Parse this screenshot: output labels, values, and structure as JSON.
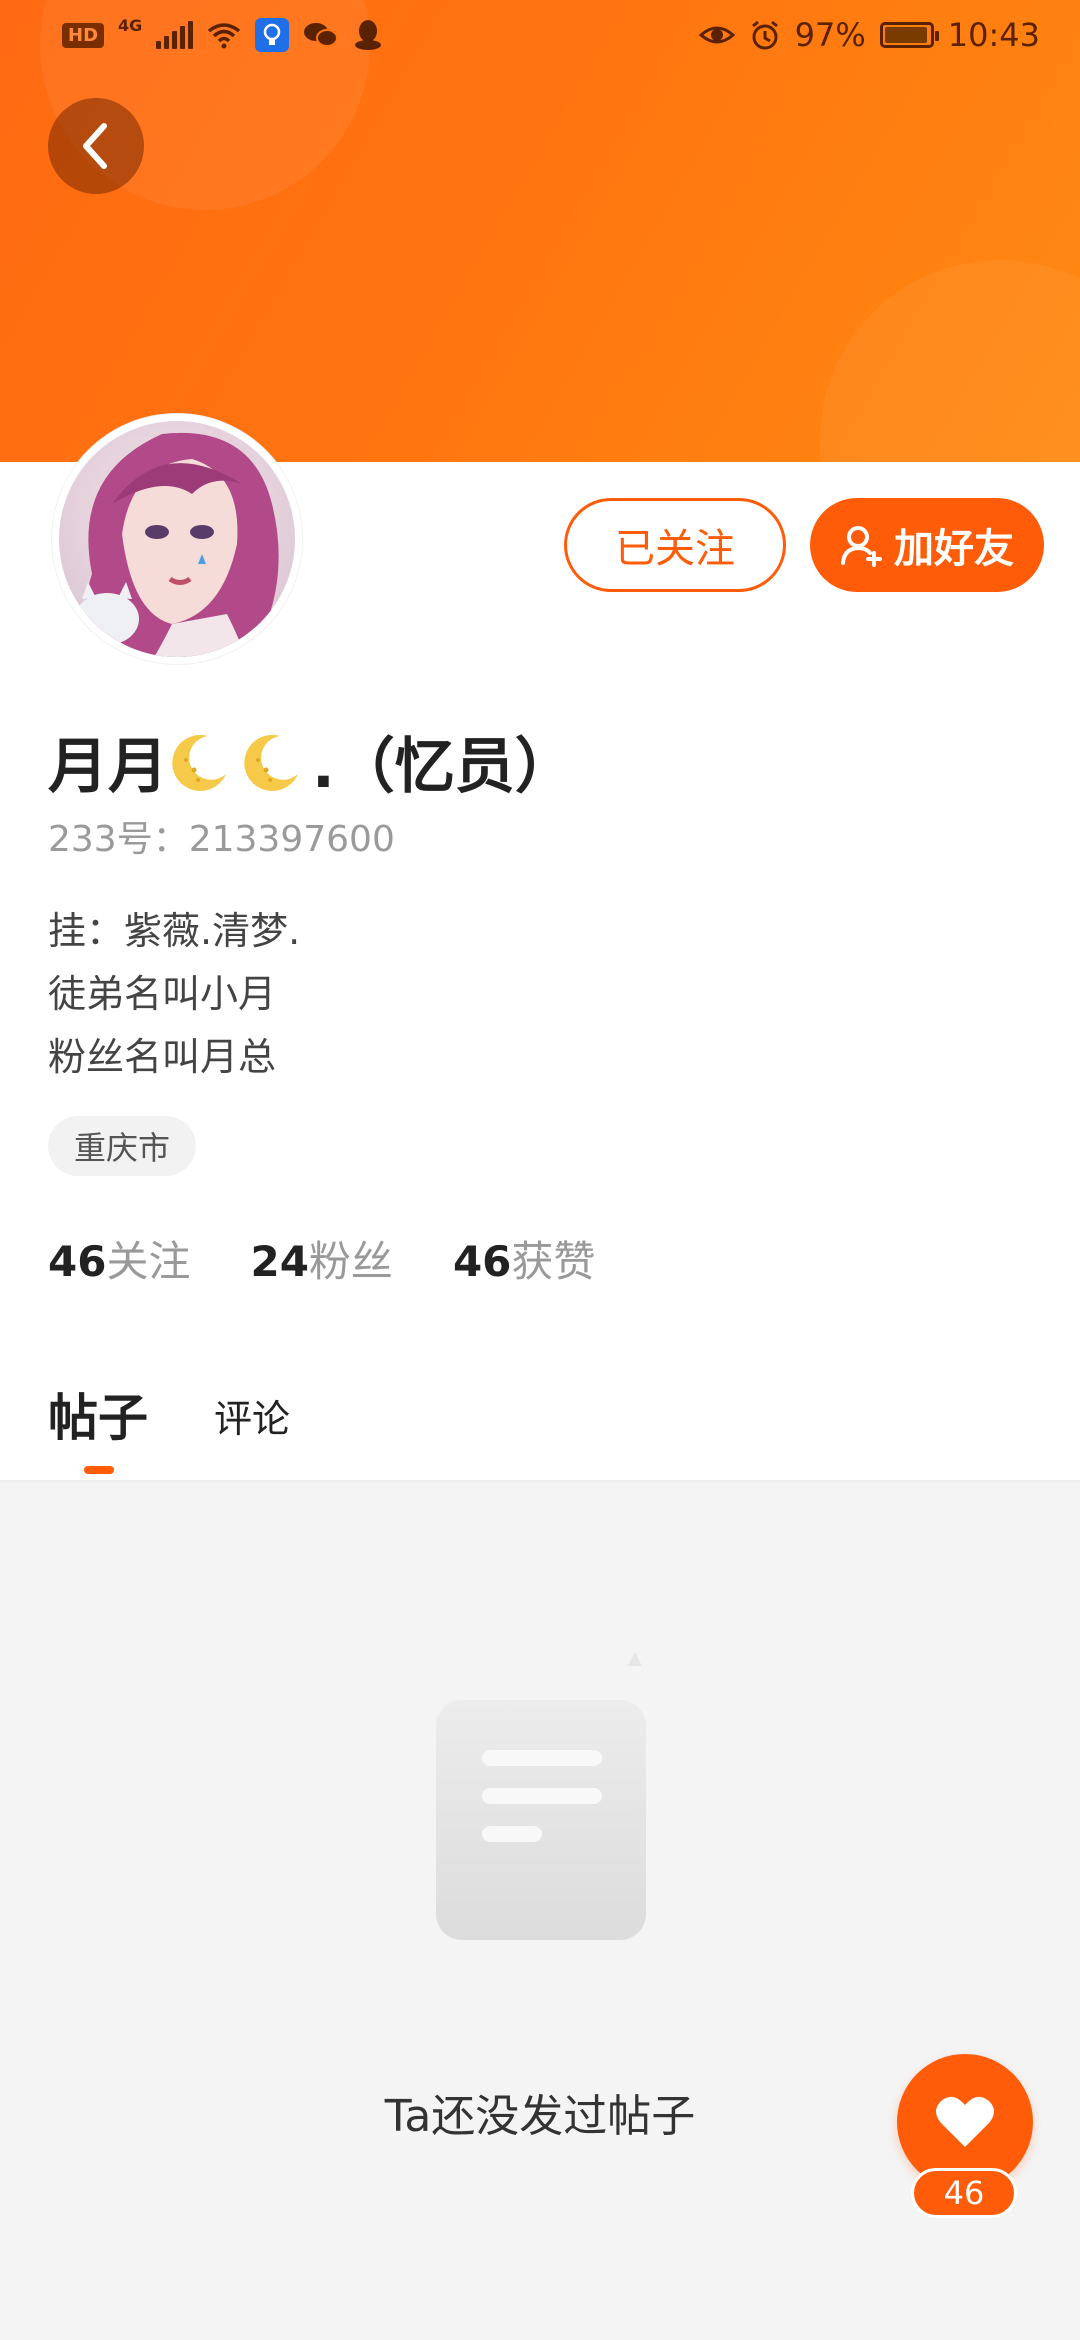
{
  "status_bar": {
    "hd": "HD",
    "network": "4G",
    "battery": "97%",
    "time": "10:43"
  },
  "profile": {
    "username": "月月🌙🌙.（忆员）",
    "username_text": "月月",
    "username_suffix": ".（忆员）",
    "id_label": "233号：213397600",
    "bio_lines": [
      "挂：紫薇.清梦.",
      "徒弟名叫小月",
      "粉丝名叫月总"
    ],
    "location": "重庆市"
  },
  "actions": {
    "followed_label": "已关注",
    "add_friend_label": "加好友"
  },
  "stats": [
    {
      "num": "46",
      "label": "关注"
    },
    {
      "num": "24",
      "label": "粉丝"
    },
    {
      "num": "46",
      "label": "获赞"
    }
  ],
  "tabs": {
    "posts": "帖子",
    "comments": "评论"
  },
  "empty_state": {
    "message": "Ta还没发过帖子"
  },
  "like_fab": {
    "count": "46"
  },
  "colors": {
    "brand": "#ff5c0a",
    "banner_start": "#ff6a12",
    "banner_end": "#ff8a12"
  },
  "icons": {
    "back": "chevron-left-icon",
    "add_friend": "add-user-icon",
    "like": "heart-icon",
    "moon": "crescent-moon-icon",
    "eye": "eye-icon",
    "alarm": "alarm-icon"
  }
}
